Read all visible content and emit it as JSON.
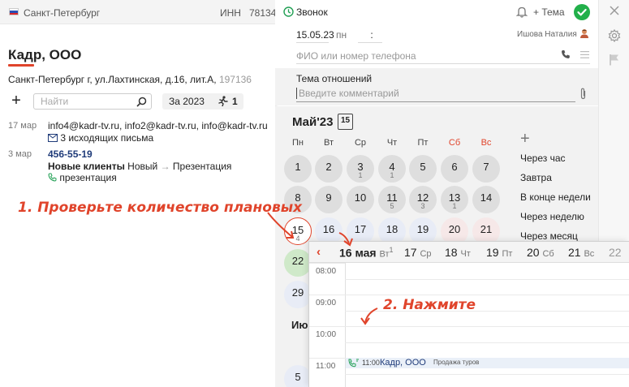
{
  "left": {
    "city": "Санкт-Петербург",
    "inn_label": "ИНН",
    "inn_value": "78134",
    "company": "Кадр, ООО",
    "address": "Санкт-Петербург г, ул.Лахтинская, д.16, лит.А,",
    "zip": "197136",
    "search_placeholder": "Найти",
    "period": "За 2023",
    "activity_count": "1",
    "activities": [
      {
        "date": "17 мар",
        "line1": "info4@kadr-tv.ru, info2@kadr-tv.ru, info@kadr-tv.ru",
        "line2": "3 исходящих письма"
      },
      {
        "date": "3 мар",
        "phone": "456-55-19",
        "funnel": "Новые клиенты",
        "stage_from": "Новый",
        "stage_to": "Презентация",
        "line3": "презентация"
      }
    ],
    "colors": {
      "accent": "#e0442b",
      "flag_white": "#ffffff",
      "flag_blue": "#2a4fb5",
      "flag_red": "#d8262a"
    }
  },
  "form": {
    "type": "Звонок",
    "topic_button": "Тема",
    "date": "15.05.23",
    "dow": "пн",
    "time": ":",
    "owner": "Ишова Наталия",
    "contact_placeholder": "ФИО или номер телефона",
    "topic_label": "Тема отношений",
    "comment_placeholder": "Введите комментарий"
  },
  "calendar": {
    "month": "Май'23",
    "icon_day": "15",
    "weekdays": [
      "Пн",
      "Вт",
      "Ср",
      "Чт",
      "Пт",
      "Сб",
      "Вс"
    ],
    "rows": [
      [
        {
          "d": "1"
        },
        {
          "d": "2"
        },
        {
          "d": "3",
          "n": "1"
        },
        {
          "d": "4",
          "n": "1"
        },
        {
          "d": "5"
        },
        {
          "d": "6"
        },
        {
          "d": "7"
        }
      ],
      [
        {
          "d": "8"
        },
        {
          "d": "9"
        },
        {
          "d": "10"
        },
        {
          "d": "11",
          "n": "5"
        },
        {
          "d": "12",
          "n": "3"
        },
        {
          "d": "13",
          "n": "1"
        },
        {
          "d": "14"
        }
      ],
      [
        {
          "d": "15",
          "n": "4"
        },
        {
          "d": "16"
        },
        {
          "d": "17"
        },
        {
          "d": "18"
        },
        {
          "d": "19"
        },
        {
          "d": "20"
        },
        {
          "d": "21"
        }
      ],
      [
        {
          "d": "22"
        }
      ],
      [
        {
          "d": "29"
        }
      ]
    ],
    "next_month_partial": "Ию",
    "next_month_first_day": "5",
    "quick_options": [
      "Через час",
      "Завтра",
      "В конце недели",
      "Через неделю",
      "Через месяц"
    ]
  },
  "schedule": {
    "days": [
      {
        "num": "16",
        "name": "мая",
        "dow": "Вт",
        "count": "1"
      },
      {
        "num": "17",
        "dow": "Ср"
      },
      {
        "num": "18",
        "dow": "Чт"
      },
      {
        "num": "19",
        "dow": "Пт"
      },
      {
        "num": "20",
        "dow": "Сб"
      },
      {
        "num": "21",
        "dow": "Вс"
      },
      {
        "num": "22",
        "dow": ""
      }
    ],
    "hours": [
      "08:00",
      "09:00",
      "10:00",
      "11:00"
    ],
    "event": {
      "time": "11:00",
      "company": "Кадр, ООО",
      "desc": "Продажа туров"
    }
  },
  "annotations": {
    "note1": "1. Проверьте количество плановых",
    "note2": "2. Нажмите"
  }
}
